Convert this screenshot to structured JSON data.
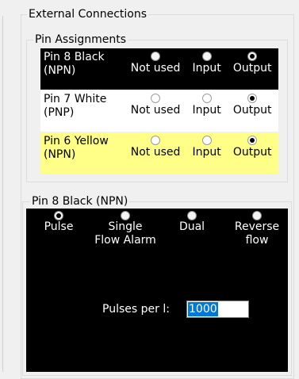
{
  "external_connections": {
    "title": "External Connections",
    "pin_assignments": {
      "title": "Pin Assignments",
      "options": [
        "Not used",
        "Input",
        "Output"
      ],
      "rows": [
        {
          "label_line1": "Pin 8 Black",
          "label_line2": "(NPN)",
          "selected": "Output",
          "background": "#000000"
        },
        {
          "label_line1": "Pin 7 White",
          "label_line2": "(PNP)",
          "selected": "Output",
          "background": "#ffffff"
        },
        {
          "label_line1": "Pin 6 Yellow",
          "label_line2": "(NPN)",
          "selected": "Output",
          "background": "#ffff88"
        }
      ]
    },
    "pin8_group": {
      "title": "Pin 8 Black (NPN)",
      "modes": [
        {
          "label": "Pulse",
          "selected": true
        },
        {
          "label": "Single\nFlow Alarm",
          "selected": false
        },
        {
          "label": "Dual",
          "selected": false
        },
        {
          "label": "Reverse\nflow",
          "selected": false
        }
      ],
      "pulses_label": "Pulses per l:",
      "pulses_value": "1000"
    }
  }
}
